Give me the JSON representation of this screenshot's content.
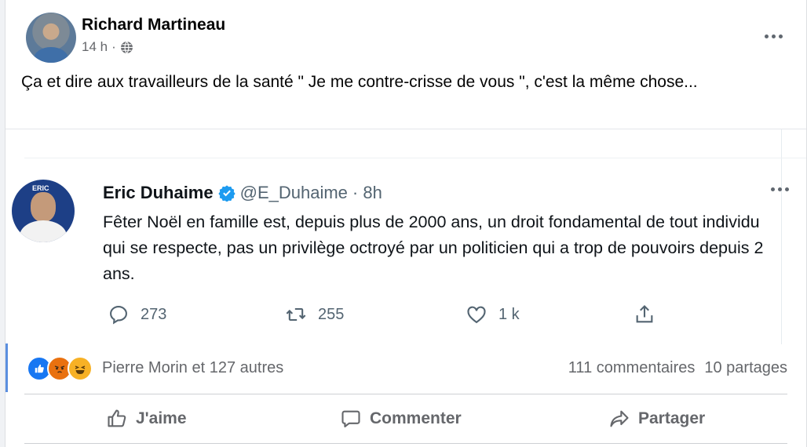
{
  "post": {
    "author": "Richard Martineau",
    "time": "14 h",
    "separator": "·",
    "privacy_icon": "globe-icon",
    "text": "Ça et dire aux travailleurs de la santé \" Je me contre-crisse de vous \", c'est la même chose..."
  },
  "tweet": {
    "name": "Eric Duhaime",
    "handle": "@E_Duhaime",
    "time": "· 8h",
    "text": "Fêter Noël en famille est, depuis plus de 2000 ans, un droit fondamental de tout individu qui se respecte, pas un privilège octroyé par un politicien qui a trop de pouvoirs depuis 2 ans.",
    "replies": "273",
    "retweets": "255",
    "likes": "1 k"
  },
  "reactions": {
    "names": "Pierre Morin et 127 autres",
    "comments": "111 commentaires",
    "shares": "10 partages"
  },
  "actions": {
    "like": "J'aime",
    "comment": "Commenter",
    "share": "Partager"
  },
  "colors": {
    "like_blue": "#1877f2",
    "angry": "#e9710f",
    "haha": "#f7b125"
  }
}
